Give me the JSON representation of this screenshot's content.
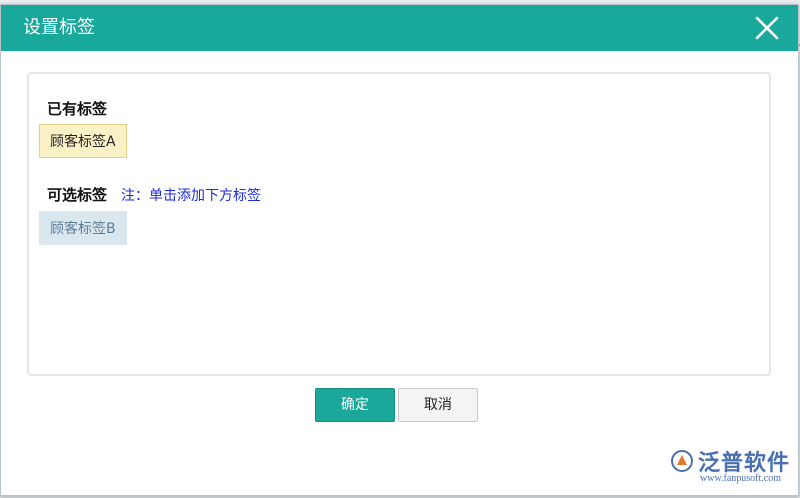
{
  "dialog": {
    "title": "设置标签",
    "owned_label": "已有标签",
    "owned_tags": [
      "顾客标签A"
    ],
    "available_label": "可选标签",
    "available_note": "注：单击添加下方标签",
    "available_tags": [
      "顾客标签B"
    ],
    "ok_label": "确定",
    "cancel_label": "取消"
  },
  "watermark": {
    "name": "泛普软件",
    "url": "www.fanpusoft.com"
  },
  "colors": {
    "titlebar": "#18a99c",
    "primary_button": "#1aa89a",
    "note_text": "#1d2ce0",
    "owned_tag_bg": "#fbf1c7",
    "available_tag_bg": "#dbe7ef"
  },
  "icons": {
    "close": "close-icon",
    "logo": "fanpu-logo-icon"
  }
}
